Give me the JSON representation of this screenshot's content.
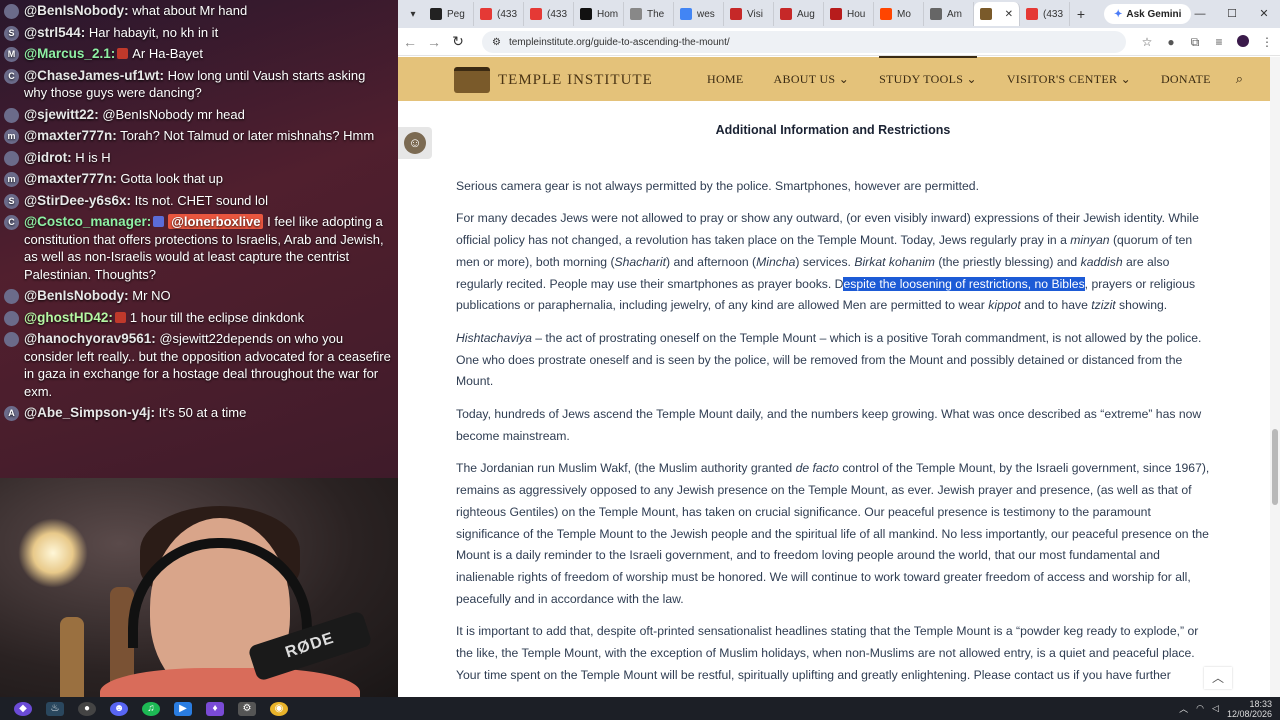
{
  "chat": {
    "messages": [
      {
        "avatar": "",
        "user": "@BenIsNobody:",
        "text": "what about Mr hand"
      },
      {
        "avatar": "S",
        "user": "@strl544:",
        "text": "Har habayit, no kh in it"
      },
      {
        "avatar": "M",
        "user": "@Marcus_2.1:",
        "text": "Ar Ha-Bayet"
      },
      {
        "avatar": "C",
        "user": "@ChaseJames-uf1wt:",
        "text": "How long until Vaush starts asking why those guys were dancing?"
      },
      {
        "avatar": "",
        "user": "@sjewitt22:",
        "text": "@BenIsNobody mr head"
      },
      {
        "avatar": "m",
        "user": "@maxter777n:",
        "text": "Torah? Not Talmud or later mishnahs? Hmm"
      },
      {
        "avatar": "",
        "user": "@idrot:",
        "text": "H is H"
      },
      {
        "avatar": "m",
        "user": "@maxter777n:",
        "text": "Gotta look that up"
      },
      {
        "avatar": "S",
        "user": "@StirDee-y6s6x:",
        "text": "Its not. CHET sound lol"
      },
      {
        "avatar": "C",
        "user": "@Costco_manager:",
        "mention": "@lonerboxlive",
        "text": "I feel like adopting a constitution that offers protections to Israelis, Arab and Jewish, as well as non-Israelis would at least capture the centrist Palestinian. Thoughts?"
      },
      {
        "avatar": "",
        "user": "@BenIsNobody:",
        "text": "Mr NO"
      },
      {
        "avatar": "",
        "user": "@ghostHD42:",
        "text": "1 hour till the eclipse dinkdonk"
      },
      {
        "avatar": "",
        "user": "@hanochyorav9561:",
        "text": "@sjewitt22depends on who you consider left really.. but the opposition advocated for a ceasefire in gaza in exchange for a hostage deal throughout the war for exm."
      },
      {
        "avatar": "A",
        "user": "@Abe_Simpson-y4j:",
        "text": "It's 50 at a time"
      }
    ],
    "mic_label": "RØDE"
  },
  "browser": {
    "tabs": [
      {
        "label": "Peg",
        "icon": "nyt-icon",
        "color": "#222222"
      },
      {
        "label": "(433",
        "icon": "youtube-icon",
        "color": "#e53935"
      },
      {
        "label": "(433",
        "icon": "youtube-icon",
        "color": "#e53935"
      },
      {
        "label": "Hom",
        "icon": "x-icon",
        "color": "#111111"
      },
      {
        "label": "The",
        "icon": "globe-icon",
        "color": "#888888"
      },
      {
        "label": "wes",
        "icon": "google-icon",
        "color": "#4285f4"
      },
      {
        "label": "Visi",
        "icon": "bookmark-icon",
        "color": "#c62828"
      },
      {
        "label": "Aug",
        "icon": "pinterest-icon",
        "color": "#c62828"
      },
      {
        "label": "Hou",
        "icon": "flag-icon",
        "color": "#b71c1c"
      },
      {
        "label": "Mo",
        "icon": "reddit-icon",
        "color": "#ff4500"
      },
      {
        "label": "Am",
        "icon": "wiki-icon",
        "color": "#666666"
      },
      {
        "label": "",
        "icon": "temple-icon",
        "color": "#7a5a2a",
        "active": true
      },
      {
        "label": "(433",
        "icon": "youtube-icon",
        "color": "#e53935"
      }
    ],
    "gemini_label": "Ask Gemini",
    "url": "templeinstitute.org/guide-to-ascending-the-mount/"
  },
  "site": {
    "brand": "TEMPLE INSTITUTE",
    "menu": [
      "HOME",
      "ABOUT US",
      "STUDY TOOLS",
      "VISITOR'S CENTER",
      "DONATE"
    ],
    "heading": "Additional Information and Restrictions",
    "p1": "Serious camera gear is not always permitted by the police. Smartphones, however are permitted.",
    "p2": {
      "a": "For many decades Jews were not allowed to pray or show any outward, (or even visibly inward) expressions of their Jewish identity. While official policy has not changed, a revolution has taken place on the Temple Mount. Today, Jews regularly pray in a ",
      "minyan": "minyan",
      "b": " (quorum of ten men or more), both morning (",
      "shacharit": "Shacharit",
      "c": ") and afternoon (",
      "mincha": "Mincha",
      "d": ") services. ",
      "birkat": "Birkat kohanim",
      "e": " (the priestly blessing) and ",
      "kaddish": "kaddish",
      "f": " are also regularly recited. People may use their smartphones as prayer books. D",
      "highlight": "espite the loosening of restrictions, no Bibles",
      "g": ", prayers or religious publications or paraphernalia, including jewelry, of any kind are allowed Men are permitted to wear ",
      "kippot": "kippot",
      "h": " and to have ",
      "tzizit": "tzizit",
      "i": " showing."
    },
    "p3": {
      "term": "Hishtachaviya",
      "text": " – the act of prostrating oneself on the Temple Mount – which is a positive Torah commandment, is not allowed by the police. One who does prostrate oneself and is seen by the police, will be removed from the Mount and possibly detained or distanced from the Mount."
    },
    "p4": "Today, hundreds of Jews ascend the Temple Mount daily, and the numbers keep growing. What was once described as “extreme” has now become mainstream.",
    "p5": {
      "a": "The Jordanian run Muslim Wakf, (the Muslim authority granted ",
      "defacto": "de facto",
      "b": " control of the Temple Mount, by the Israeli government, since 1967), remains as aggressively opposed to any Jewish presence on the Temple Mount, as ever. Jewish prayer and presence, (as well as that of righteous Gentiles) on the Temple Mount, has taken on crucial significance. Our peaceful presence is testimony to the paramount significance of the Temple Mount to the Jewish people and the spiritual life of all mankind. No less importantly, our peaceful presence on the Mount is a daily reminder to the Israeli government, and to freedom loving people around the world, that our most fundamental and inalienable rights of freedom of worship must be honored. We will continue to work toward greater freedom of access and worship for all, peacefully and in accordance with the law."
    },
    "p6": {
      "a": "It is important to add that, despite oft-printed sensationalist headlines stating that the Temple Mount is a “powder keg ready to explode,” or the like, the Temple Mount, with the exception of Muslim holidays, when non-Muslims are not allowed entry, is a quiet and peaceful place. Your time spent on the Temple Mount will be restful, spiritually uplifting and greatly enlightening. Please ",
      "link": "contact us",
      "b": " if you have further"
    }
  },
  "taskbar": {
    "time": "18:33",
    "date": "12/08/2026"
  }
}
